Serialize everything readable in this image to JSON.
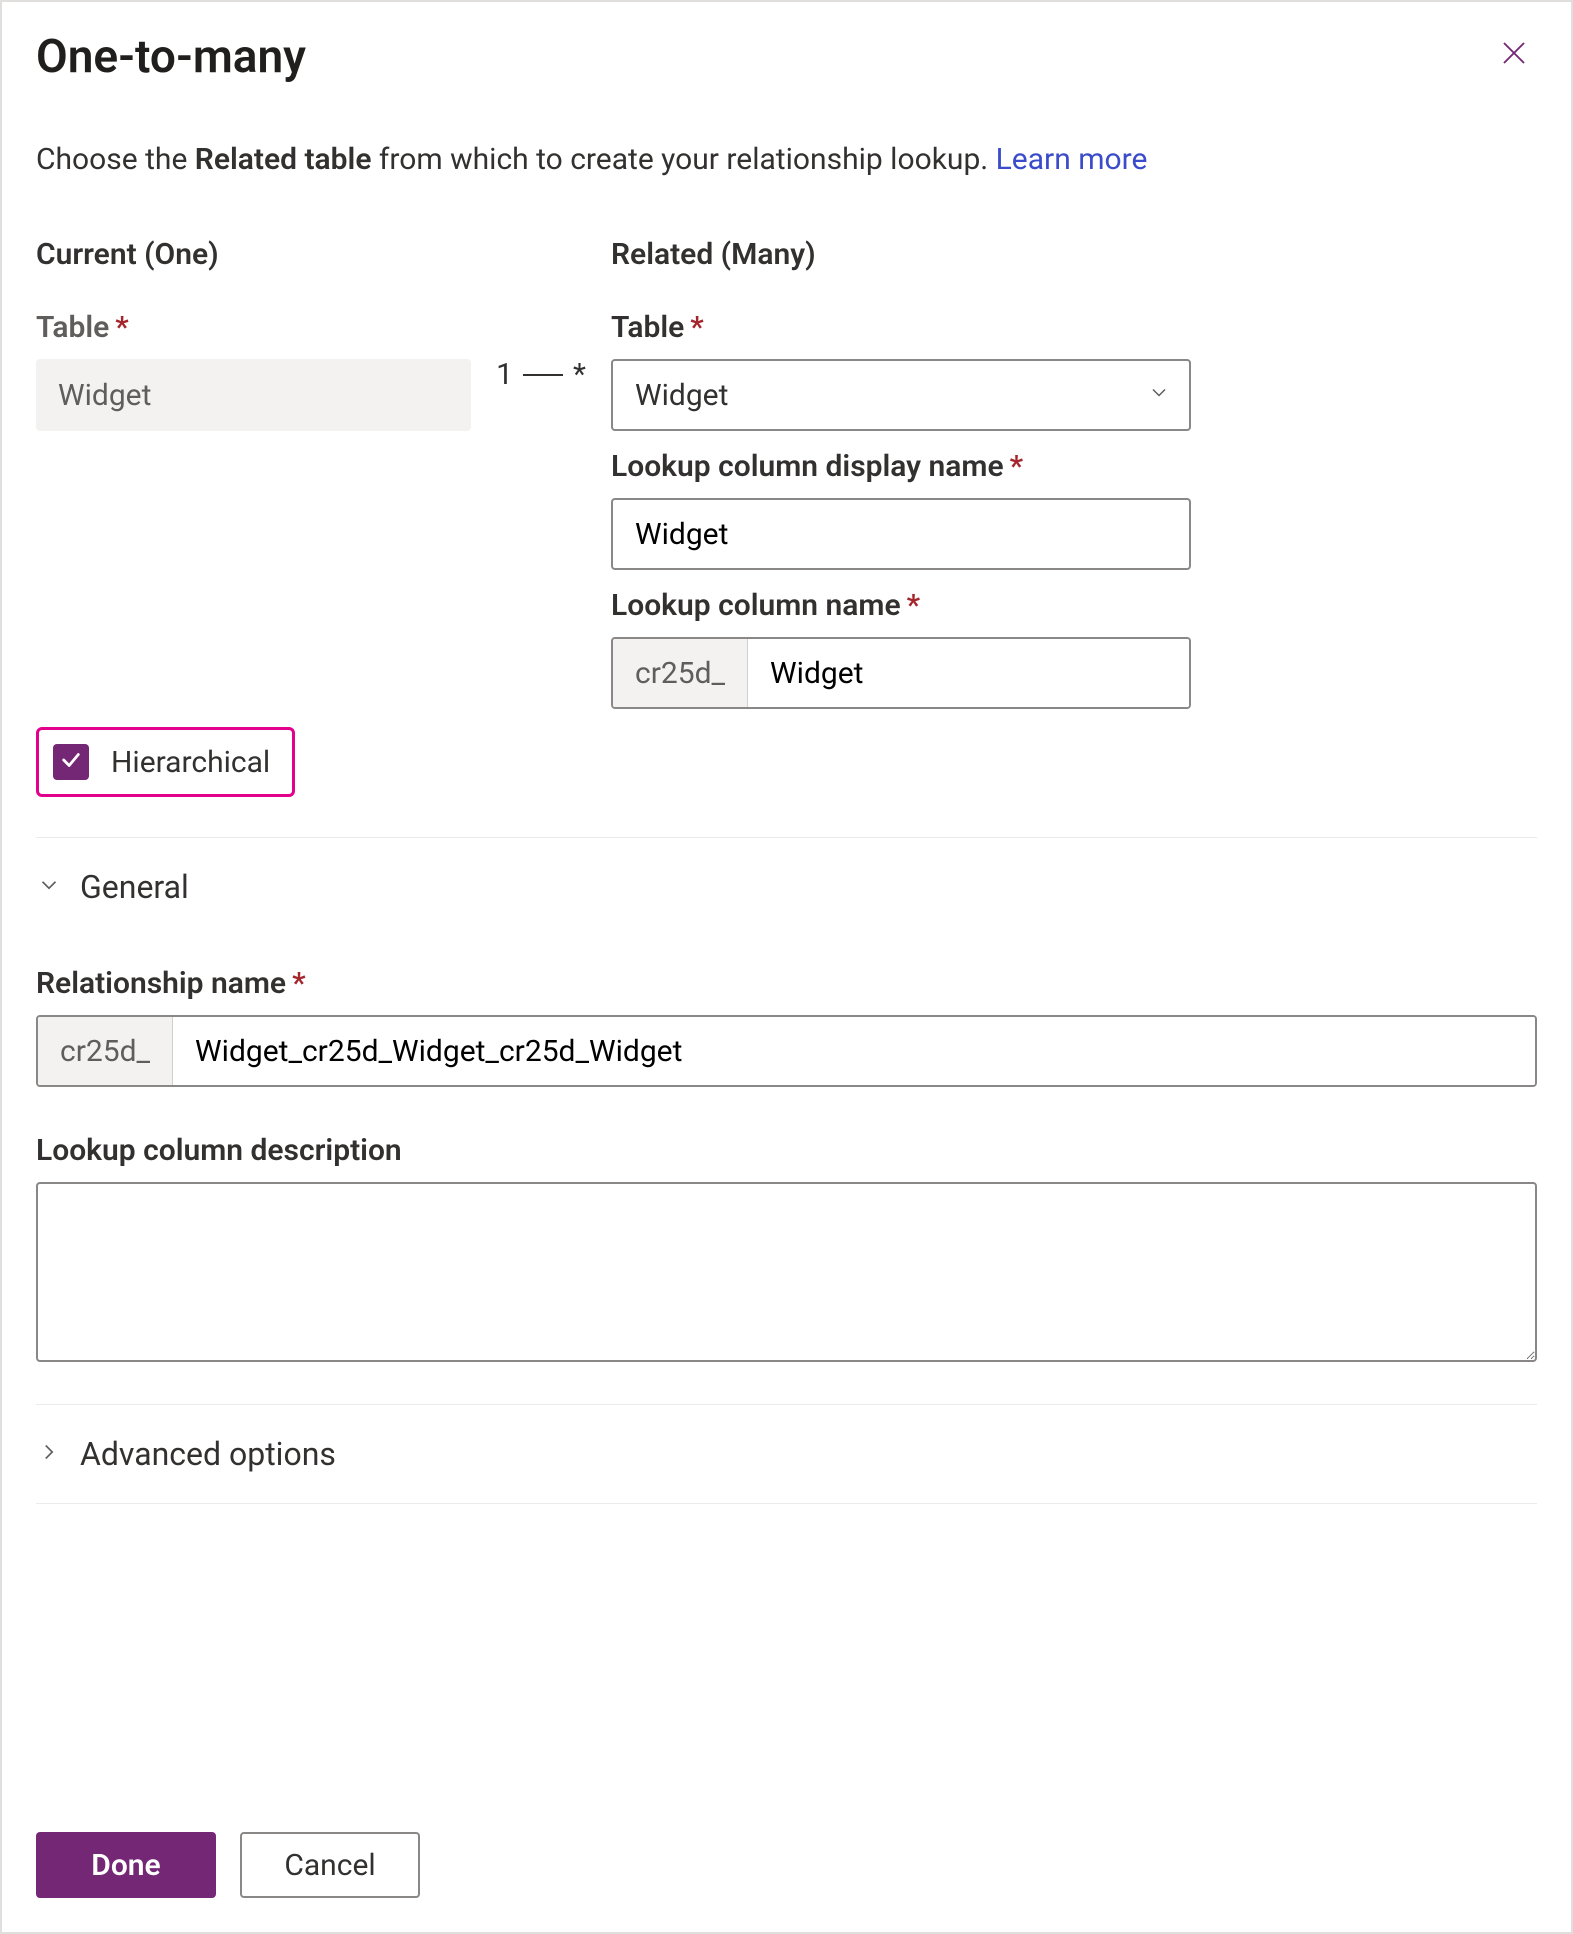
{
  "header": {
    "title": "One-to-many"
  },
  "intro": {
    "pre": "Choose the ",
    "bold": "Related table",
    "post": " from which to create your relationship lookup. ",
    "link": "Learn more"
  },
  "current": {
    "heading": "Current (One)",
    "table_label": "Table",
    "table_value": "Widget"
  },
  "relation": {
    "one": "1",
    "many": "*"
  },
  "related": {
    "heading": "Related (Many)",
    "table_label": "Table",
    "table_value": "Widget",
    "display_label": "Lookup column display name",
    "display_value": "Widget",
    "name_label": "Lookup column name",
    "name_prefix": "cr25d_",
    "name_value": "Widget"
  },
  "hierarchical": {
    "label": "Hierarchical",
    "checked": true
  },
  "sections": {
    "general": "General",
    "advanced": "Advanced options"
  },
  "general": {
    "rel_name_label": "Relationship name",
    "rel_name_prefix": "cr25d_",
    "rel_name_value": "Widget_cr25d_Widget_cr25d_Widget",
    "desc_label": "Lookup column description",
    "desc_value": ""
  },
  "footer": {
    "done": "Done",
    "cancel": "Cancel"
  }
}
